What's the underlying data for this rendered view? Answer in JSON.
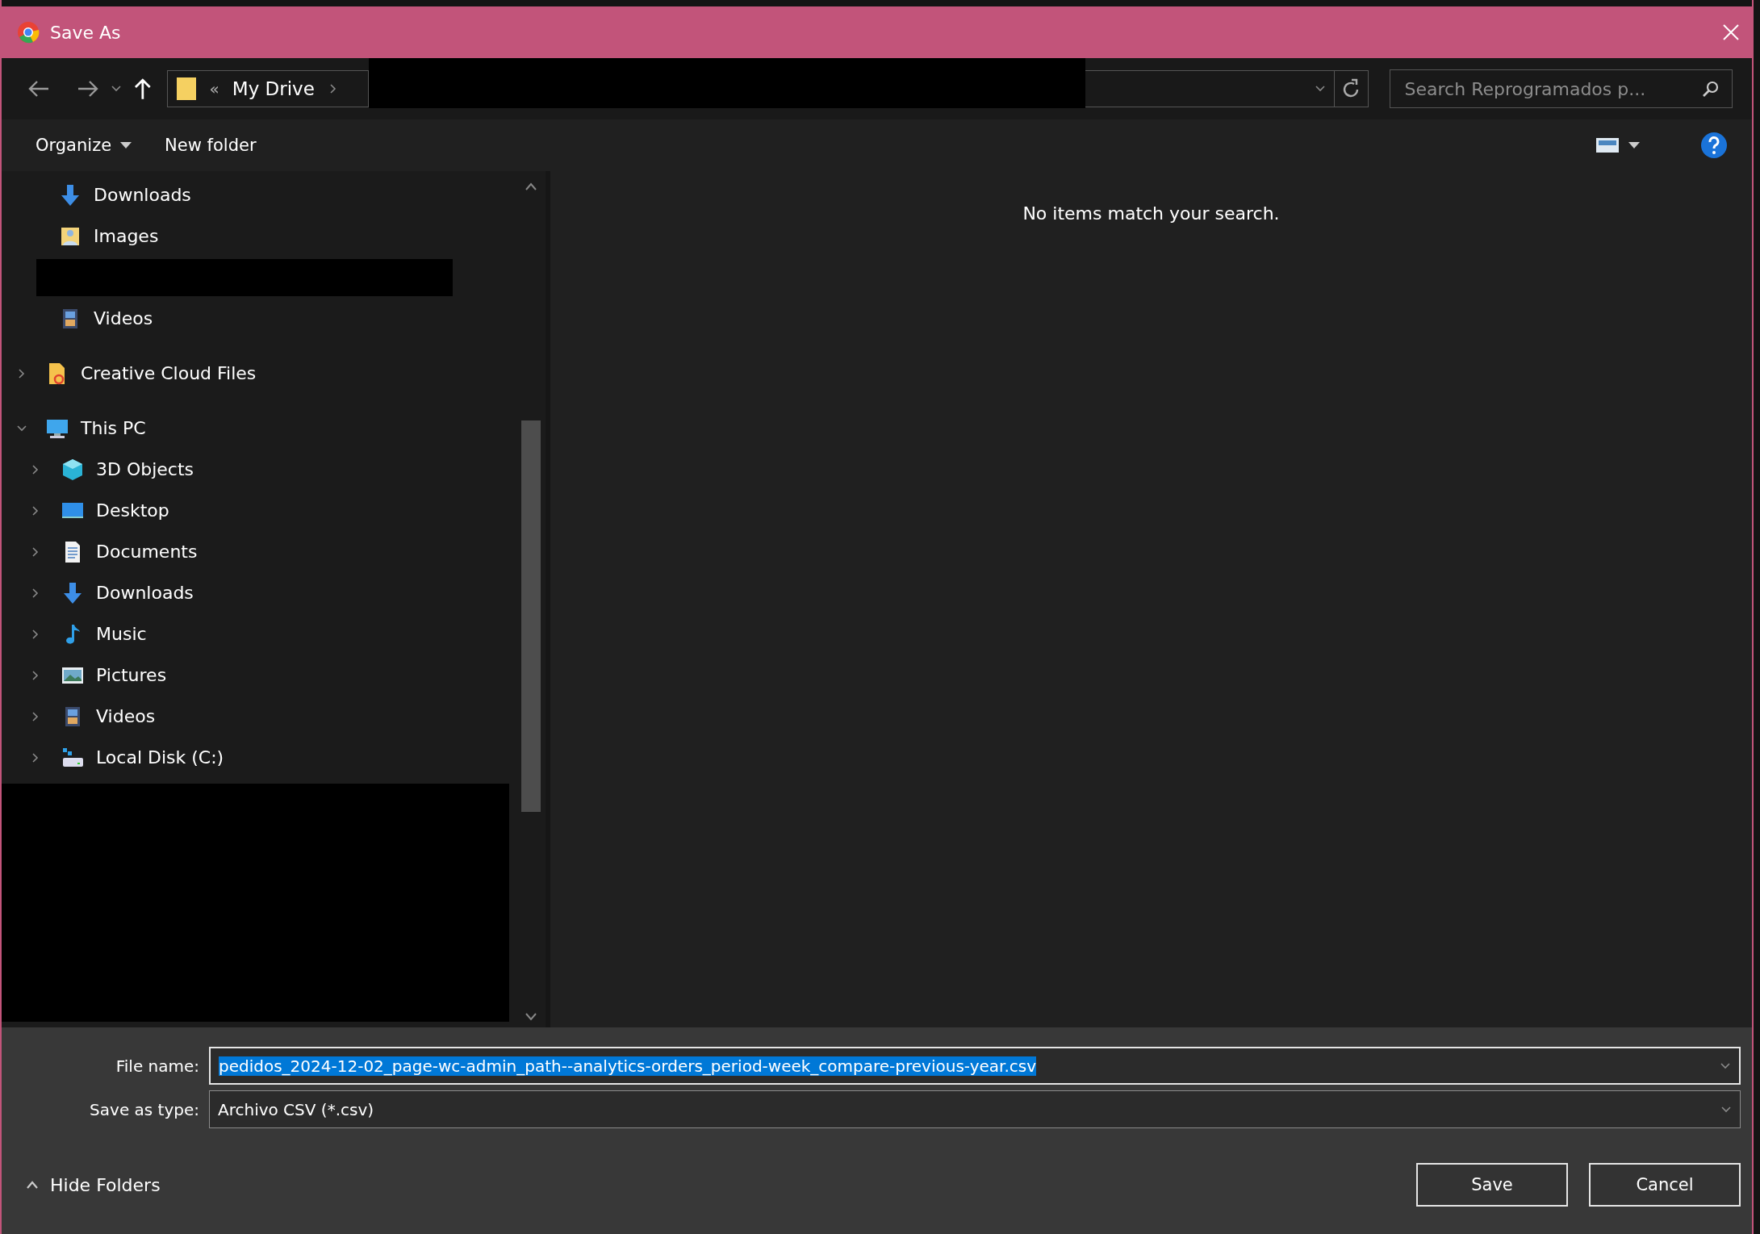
{
  "window": {
    "title": "Save As"
  },
  "address_bar": {
    "overflow_mark": "«",
    "path": [
      "My Drive"
    ]
  },
  "search": {
    "placeholder": "Search Reprogramados p..."
  },
  "toolbar": {
    "organize": "Organize",
    "new_folder": "New folder"
  },
  "sidebar": {
    "partial_group": [
      {
        "label": "Downloads",
        "kind": "downloads"
      },
      {
        "label": "Images",
        "kind": "images"
      },
      {
        "kind": "redacted"
      },
      {
        "label": "Videos",
        "kind": "videos"
      }
    ],
    "tree": [
      {
        "label": "Creative Cloud Files",
        "kind": "creative-cloud",
        "expanded": false
      },
      {
        "label": "This PC",
        "kind": "pc",
        "expanded": true,
        "children": [
          {
            "label": "3D Objects",
            "kind": "cube",
            "expanded": false
          },
          {
            "label": "Desktop",
            "kind": "desktop",
            "expanded": false
          },
          {
            "label": "Documents",
            "kind": "documents",
            "expanded": false
          },
          {
            "label": "Downloads",
            "kind": "downloads",
            "expanded": false
          },
          {
            "label": "Music",
            "kind": "music",
            "expanded": false
          },
          {
            "label": "Pictures",
            "kind": "pictures",
            "expanded": false
          },
          {
            "label": "Videos",
            "kind": "videos",
            "expanded": false
          },
          {
            "label": "Local Disk (C:)",
            "kind": "disk",
            "expanded": false
          }
        ]
      }
    ]
  },
  "content": {
    "empty_message": "No items match your search."
  },
  "file_name": {
    "label": "File name:",
    "value": "pedidos_2024-12-02_page-wc-admin_path--analytics-orders_period-week_compare-previous-year.csv",
    "text_selected": true
  },
  "save_as_type": {
    "label": "Save as type:",
    "value": "Archivo CSV (*.csv)"
  },
  "hide_folders": "Hide Folders",
  "buttons": [
    "Save",
    "Cancel"
  ]
}
